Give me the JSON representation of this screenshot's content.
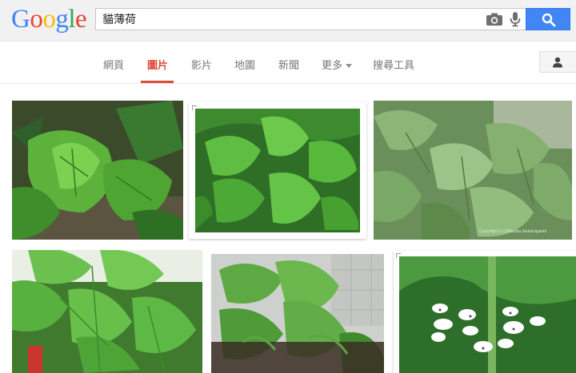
{
  "search": {
    "query": "貓薄荷",
    "logo": "Google"
  },
  "tabs": {
    "web": "網頁",
    "images": "圖片",
    "videos": "影片",
    "maps": "地圖",
    "news": "新聞",
    "more": "更多",
    "tools": "搜尋工具"
  },
  "results": {
    "watermark": "Copyright (c) Ritsuko Kakahigashi"
  },
  "icons": {
    "camera": "camera-icon",
    "mic": "microphone-icon",
    "search": "magnifier-icon",
    "account": "person-icon"
  },
  "colors": {
    "accent_red": "#dd4b39",
    "search_blue": "#4285f4"
  }
}
